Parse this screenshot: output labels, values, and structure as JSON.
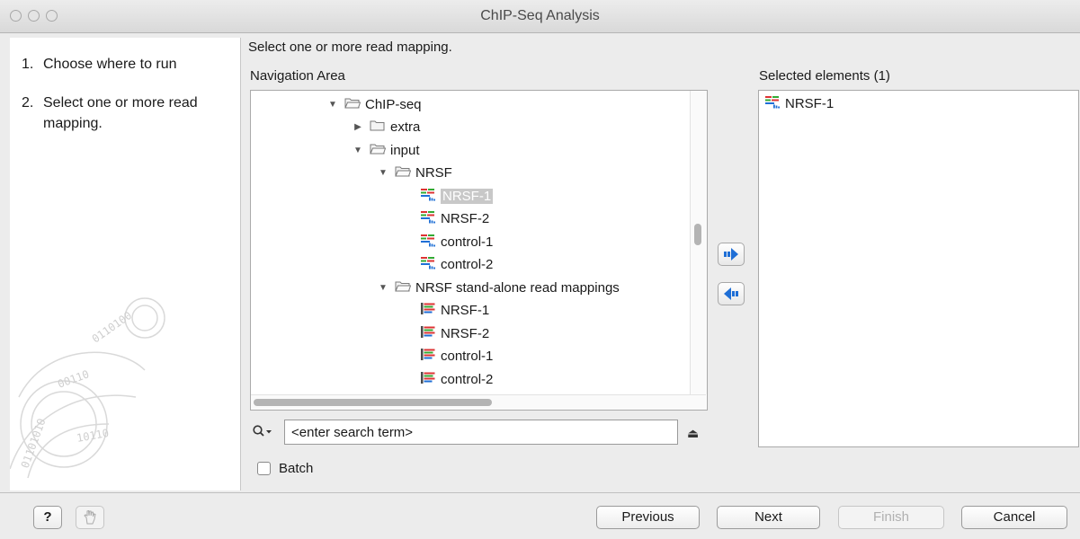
{
  "window": {
    "title": "ChIP-Seq Analysis"
  },
  "steps": [
    {
      "num": "1.",
      "label": "Choose where to run"
    },
    {
      "num": "2.",
      "label": "Select one or more read mapping."
    }
  ],
  "main": {
    "instruction": "Select one or more read mapping.",
    "navigation_label": "Navigation Area",
    "selected_label": "Selected elements (1)"
  },
  "tree": [
    {
      "label": "ChIP-seq",
      "icon": "folder-open-icon",
      "toggle": "▼",
      "selected": false
    },
    {
      "label": "extra",
      "icon": "folder-icon",
      "toggle": "▶",
      "selected": false
    },
    {
      "label": "input",
      "icon": "folder-open-icon",
      "toggle": "▼",
      "selected": false
    },
    {
      "label": "NRSF",
      "icon": "folder-open-icon",
      "toggle": "▼",
      "selected": false
    },
    {
      "label": "NRSF-1",
      "icon": "read-mapping-icon",
      "toggle": "",
      "selected": true
    },
    {
      "label": "NRSF-2",
      "icon": "read-mapping-icon",
      "toggle": "",
      "selected": false
    },
    {
      "label": "control-1",
      "icon": "read-mapping-icon",
      "toggle": "",
      "selected": false
    },
    {
      "label": "control-2",
      "icon": "read-mapping-icon",
      "toggle": "",
      "selected": false
    },
    {
      "label": "NRSF stand-alone read mappings",
      "icon": "folder-open-icon",
      "toggle": "▼",
      "selected": false
    },
    {
      "label": "NRSF-1",
      "icon": "standalone-mapping-icon",
      "toggle": "",
      "selected": false
    },
    {
      "label": "NRSF-2",
      "icon": "standalone-mapping-icon",
      "toggle": "",
      "selected": false
    },
    {
      "label": "control-1",
      "icon": "standalone-mapping-icon",
      "toggle": "",
      "selected": false
    },
    {
      "label": "control-2",
      "icon": "standalone-mapping-icon",
      "toggle": "",
      "selected": false
    }
  ],
  "selected_elements": [
    {
      "label": "NRSF-1",
      "icon": "read-mapping-icon"
    }
  ],
  "search": {
    "placeholder": "<enter search term>"
  },
  "batch": {
    "label": "Batch",
    "checked": false
  },
  "buttons": {
    "help": "?",
    "previous": "Previous",
    "next": "Next",
    "finish": "Finish",
    "cancel": "Cancel"
  },
  "colors": {
    "selection": "#c8c8c8",
    "arrow_blue": "#1f6fd6"
  }
}
